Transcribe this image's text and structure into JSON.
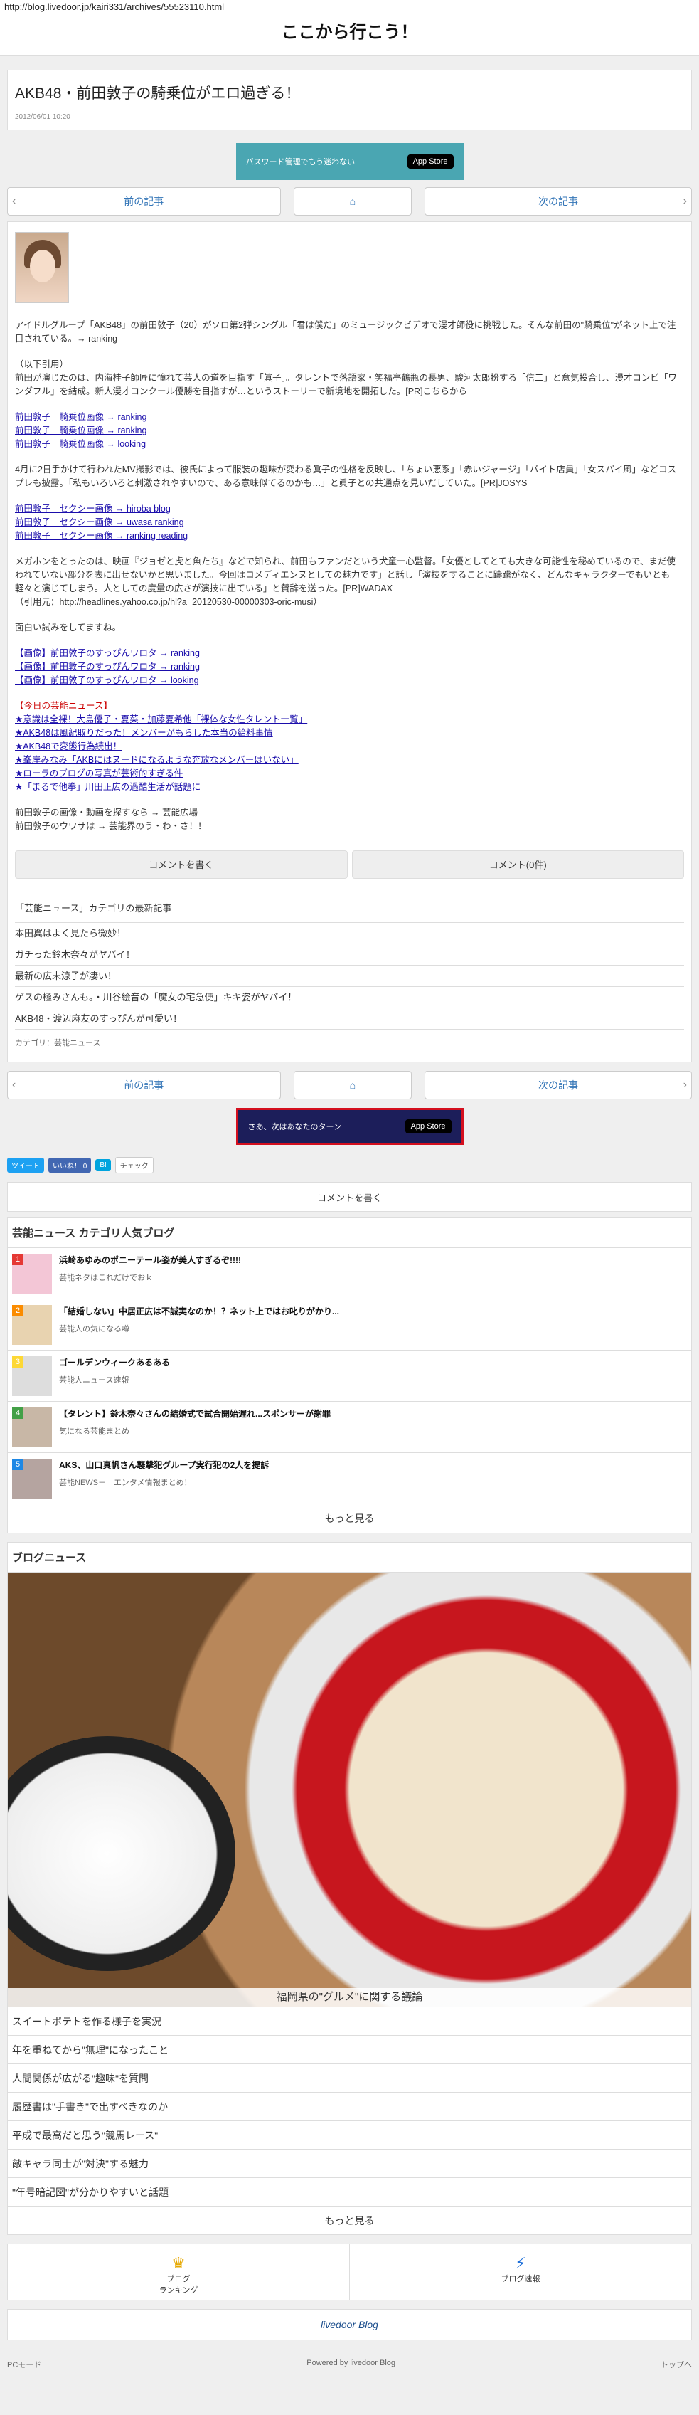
{
  "browser": {
    "url": "http://blog.livedoor.jp/kairi331/archives/55523110.html"
  },
  "blog": {
    "title": "ここから行こう！"
  },
  "article": {
    "title": "AKB48・前田敦子の騎乗位がエロ過ぎる！",
    "date": "2012/06/01 10:20",
    "body": [
      "アイドルグループ「AKB48」の前田敦子（20）がソロ第2弾シングル「君は僕だ」のミュージックビデオで漫才師役に挑戦した。そんな前田の\"騎乗位\"がネット上で注目されている。→ ranking",
      "（以下引用）",
      "前田が演じたのは、内海桂子師匠に憧れて芸人の道を目指す「眞子」。タレントで落語家・笑福亭鶴瓶の長男、駿河太郎扮する「信二」と意気投合し、漫才コンビ「ワンダフル」を結成。新人漫才コンクール優勝を目指すが…というストーリーで新境地を開拓した。[PR]こちらから",
      "前田敦子　騎乗位画像 → ranking",
      "前田敦子　騎乗位画像 → ranking",
      "前田敦子　騎乗位画像 → looking",
      "4月に2日手かけて行われたMV撮影では、彼氏によって服装の趣味が変わる眞子の性格を反映し、「ちょい悪系」「赤いジャージ」「バイト店員」「女スパイ風」などコスプレも披露。「私もいろいろと刺激されやすいので、ある意味似てるのかも…」と眞子との共通点を見いだしていた。[PR]JOSYS",
      "前田敦子　セクシー画像 → hiroba blog",
      "前田敦子　セクシー画像 → uwasa ranking",
      "前田敦子　セクシー画像 → ranking reading",
      "メガホンをとったのは、映画『ジョゼと虎と魚たち』などで知られ、前田もファンだという犬童一心監督。「女優としてとても大きな可能性を秘めているので、まだ使われていない部分を表に出せないかと思いました。今回はコメディエンヌとしての魅力です」と話し「演技をすることに躊躇がなく、どんなキャラクターでもいとも軽々と演じてしまう。人としての度量の広さが演技に出ている」と賛辞を送った。[PR]WADAX",
      "（引用元：http://headlines.yahoo.co.jp/hl?a=20120530-00000303-oric-musi）",
      "面白い試みをしてますね。",
      "【画像】前田敦子のすっぴんワロタ → ranking",
      "【画像】前田敦子のすっぴんワロタ → ranking",
      "【画像】前田敦子のすっぴんワロタ → looking",
      "【今日の芸能ニュース】",
      "★意識は全裸！大島優子・夏菜・加藤夏希他「裸体な女性タレント一覧」",
      "★AKB48は風紀取りだった！メンバーがもらした本当の給料事情",
      "★AKB48で変態行為続出！",
      "★峯岸みなみ「AKBにはヌードになるような奔放なメンバーはいない」",
      "★ローラのブログの写真が芸術的すぎる件",
      "★「まるで他拳」川田正広の過酷生活が話題に",
      "前田敦子の画像・動画を探すなら → 芸能広場",
      "前田敦子のウワサは → 芸能界のう・わ・さ！！"
    ]
  },
  "banners": {
    "top": {
      "text": "パスワード管理でもう迷わない",
      "store": "App Store"
    },
    "bottom": {
      "text": "さあ、次はあなたのターン",
      "store": "App Store"
    }
  },
  "pager": {
    "prev": "前の記事",
    "next": "次の記事"
  },
  "comments": {
    "write": "コメントを書く",
    "count": "コメント(0件)"
  },
  "category_news": {
    "title": "「芸能ニュース」カテゴリの最新記事",
    "items": [
      "本田翼はよく見たら微妙！",
      "ガチった鈴木奈々がヤバイ！",
      "最新の広末涼子が凄い！",
      "ゲスの極みさんも。・川谷絵音の「魔女の宅急便」キキ姿がヤバイ！",
      "AKB48・渡辺麻友のすっぴんが可愛い！"
    ],
    "category_label": "カテゴリ：芸能ニュース"
  },
  "share": {
    "tweet": "ツイート",
    "like": "いいね！ 0",
    "hatena": "B!",
    "check": "チェック"
  },
  "write_comment": "コメントを書く",
  "popular": {
    "title": "芸能ニュース カテゴリ人気ブログ",
    "items": [
      {
        "rank": "1",
        "title": "浜崎あゆみのポニーテール姿が美人すぎるぞ!!!!",
        "sub": "芸能ネタはこれだけでおｋ",
        "color": "#e53935"
      },
      {
        "rank": "2",
        "title": "「結婚しない」中居正広は不誠実なのか！？ネット上ではお叱りがかり...",
        "sub": "芸能人の気になる噂",
        "color": "#fb8c00"
      },
      {
        "rank": "3",
        "title": "ゴールデンウィークあるある",
        "sub": "芸能人ニュース速報",
        "color": "#fdd835"
      },
      {
        "rank": "4",
        "title": "【タレント】鈴木奈々さんの結婚式で試合開始遅れ...スポンサーが謝罪",
        "sub": "気になる芸能まとめ",
        "color": "#43a047"
      },
      {
        "rank": "5",
        "title": "AKS、山口真帆さん襲撃犯グループ実行犯の2人を提訴",
        "sub": "芸能NEWS＋｜エンタメ情報まとめ！",
        "color": "#1e88e5"
      }
    ],
    "more": "もっと見る"
  },
  "blog_news": {
    "title": "ブログニュース",
    "image_caption": "福岡県の\"グルメ\"に関する議論",
    "items": [
      "スイートポテトを作る様子を実況",
      "年を重ねてから\"無理\"になったこと",
      "人間関係が広がる\"趣味\"を質問",
      "履歴書は\"手書き\"で出すべきなのか",
      "平成で最高だと思う\"競馬レース\"",
      "敵キャラ同士が\"対決\"する魅力",
      "\"年号暗記図\"が分かりやすいと話題"
    ],
    "more": "もっと見る"
  },
  "footer": {
    "ranking": "ブログ\nランキング",
    "report": "ブログ速報",
    "logo": "livedoor Blog",
    "pc_mode": "PCモード",
    "powered": "Powered by livedoor Blog",
    "top": "トップへ"
  }
}
